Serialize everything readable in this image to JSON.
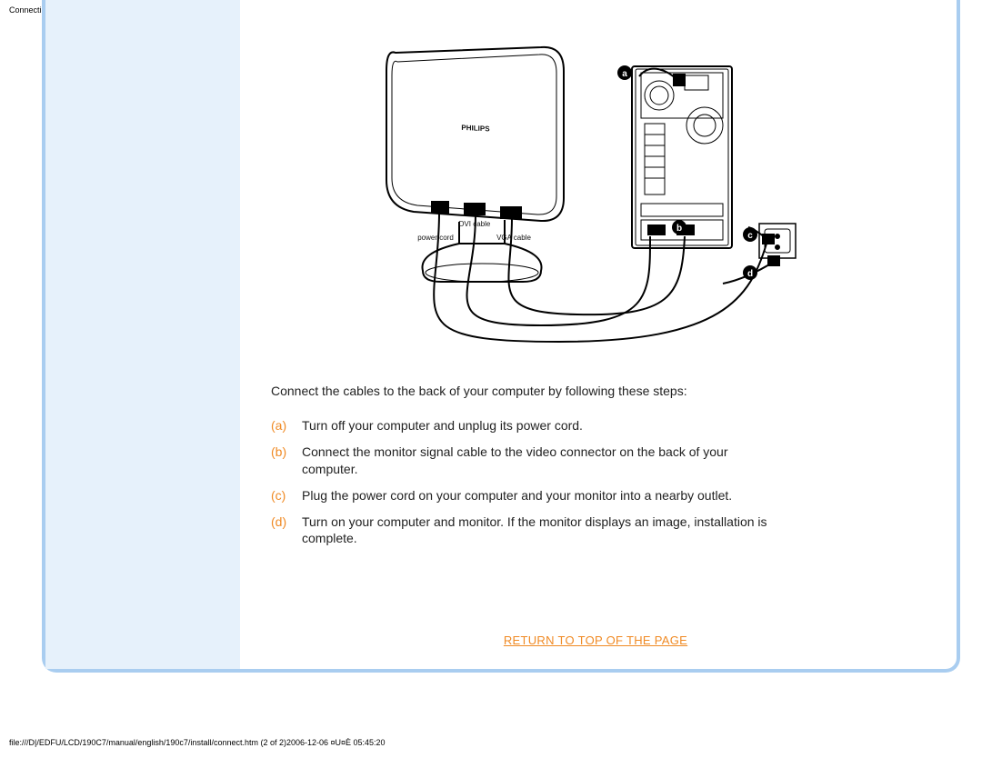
{
  "header": {
    "title": "Connecting to Your PC"
  },
  "footer": {
    "path": "file:///D|/EDFU/LCD/190C7/manual/english/190c7/install/connect.htm (2 of 2)2006-12-06 ¤U¤È 05:45:20"
  },
  "diagram": {
    "brand": "PHILIPS",
    "labels": {
      "dvi": "DVI cable",
      "power": "power cord",
      "vga": "VGA cable"
    },
    "badges": {
      "a": "a",
      "b": "b",
      "c": "c",
      "d": "d"
    }
  },
  "content": {
    "intro": "Connect the cables to the back of your computer by following these steps:",
    "steps": [
      {
        "bullet": "(a)",
        "text": "Turn off your computer and unplug its power cord."
      },
      {
        "bullet": "(b)",
        "text": "Connect the monitor signal cable to the video connector on the back of your computer."
      },
      {
        "bullet": "(c)",
        "text": "Plug the power cord on your computer and your monitor into a nearby outlet."
      },
      {
        "bullet": "(d)",
        "text": "Turn on your computer and monitor. If the monitor displays an image, installation is complete."
      }
    ],
    "return_link": "RETURN TO TOP OF THE PAGE"
  }
}
